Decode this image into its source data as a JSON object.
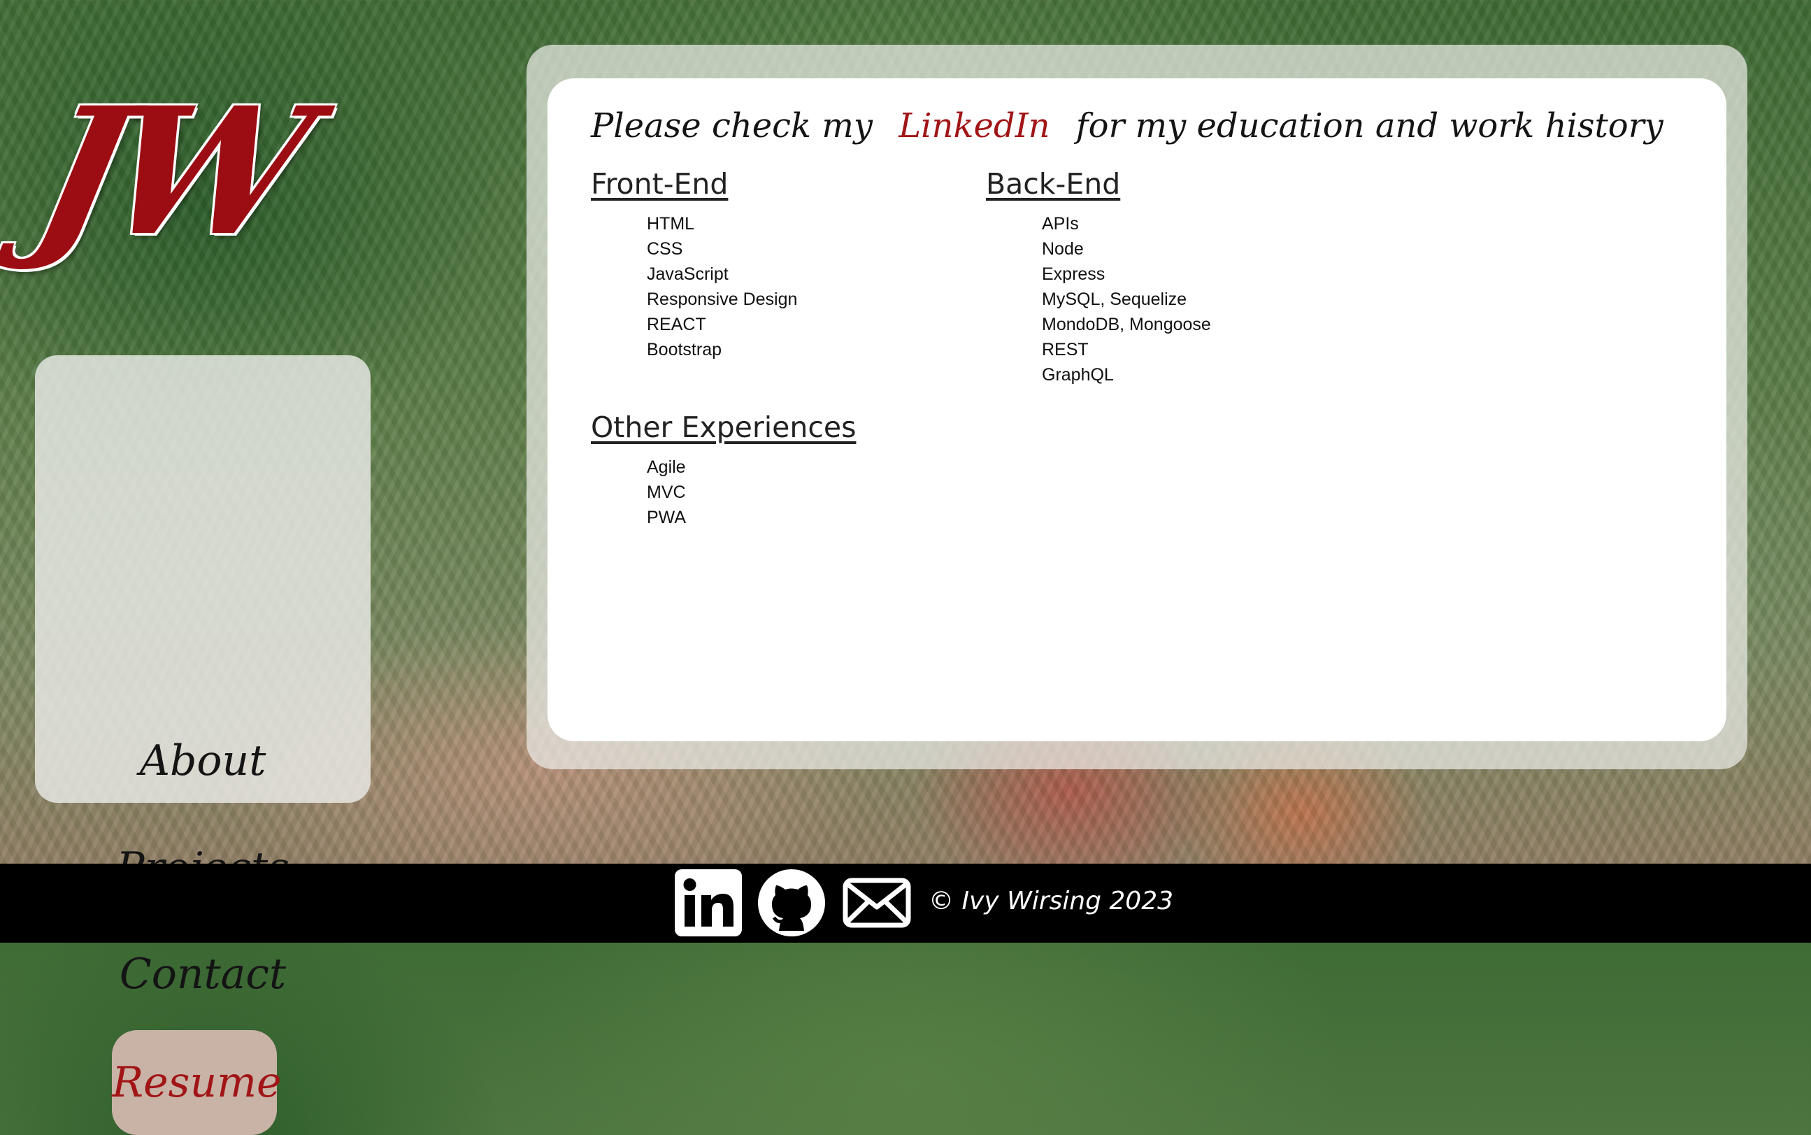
{
  "logo": {
    "text": "JW"
  },
  "nav": {
    "items": [
      {
        "label": "About"
      },
      {
        "label": "Projects"
      },
      {
        "label": "Contact"
      },
      {
        "label": "Resume"
      }
    ]
  },
  "main": {
    "headline_before": "Please check my",
    "headline_link": "LinkedIn",
    "headline_after": "for my education and work history",
    "sections": [
      {
        "title": "Front-End",
        "items": [
          "HTML",
          "CSS",
          "JavaScript",
          "Responsive Design",
          "REACT",
          "Bootstrap"
        ]
      },
      {
        "title": "Back-End",
        "items": [
          "APIs",
          "Node",
          "Express",
          "MySQL, Sequelize",
          "MondoDB, Mongoose",
          "REST",
          "GraphQL"
        ]
      },
      {
        "title": "Other Experiences",
        "items": [
          "Agile",
          "MVC",
          "PWA"
        ]
      }
    ]
  },
  "footer": {
    "icons": [
      "linkedin-icon",
      "github-icon",
      "email-icon"
    ],
    "copyright": "© Ivy Wirsing 2023"
  },
  "colors": {
    "accent": "#a11517",
    "active_nav_bg": "#c9b3a7",
    "footer_bg": "#000000"
  }
}
